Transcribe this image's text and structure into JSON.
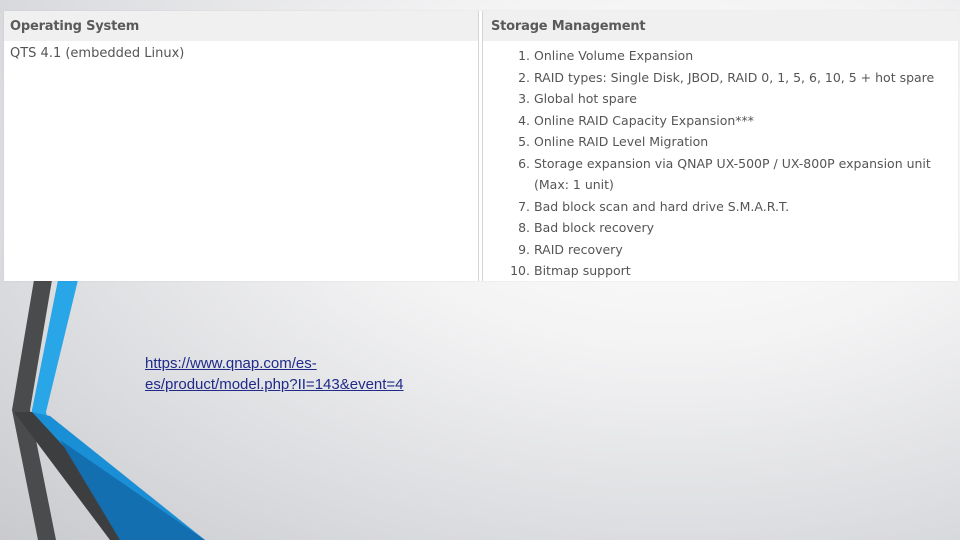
{
  "spec_table": {
    "operating_system": {
      "header": "Operating System",
      "value": "QTS 4.1 (embedded Linux)"
    },
    "storage_management": {
      "header": "Storage Management",
      "items": [
        {
          "number": "1.",
          "text": "Online Volume Expansion"
        },
        {
          "number": "2.",
          "text": "RAID types: Single Disk, JBOD, RAID 0, 1, 5, 6, 10, 5 + hot spare"
        },
        {
          "number": "3.",
          "text": "Global hot spare"
        },
        {
          "number": "4.",
          "text": "Online RAID Capacity Expansion***"
        },
        {
          "number": "5.",
          "text": "Online RAID Level Migration"
        },
        {
          "number": "6.",
          "text": "Storage expansion via QNAP UX-500P / UX-800P expansion unit (Max: 1 unit)"
        },
        {
          "number": "7.",
          "text": "Bad block scan and hard drive S.M.A.R.T."
        },
        {
          "number": "8.",
          "text": "Bad block recovery"
        },
        {
          "number": "9.",
          "text": "RAID recovery"
        },
        {
          "number": "10.",
          "text": "Bitmap support"
        }
      ]
    }
  },
  "source_link": {
    "line1": "https://www.qnap.com/es-",
    "line2": "es/product/model.php?II=143&event=4"
  },
  "colors": {
    "accent_blue": "#1d9ae0",
    "dark_blue": "#1273b5",
    "dark_gray": "#4a4b4d",
    "link": "#1f2a8a"
  }
}
